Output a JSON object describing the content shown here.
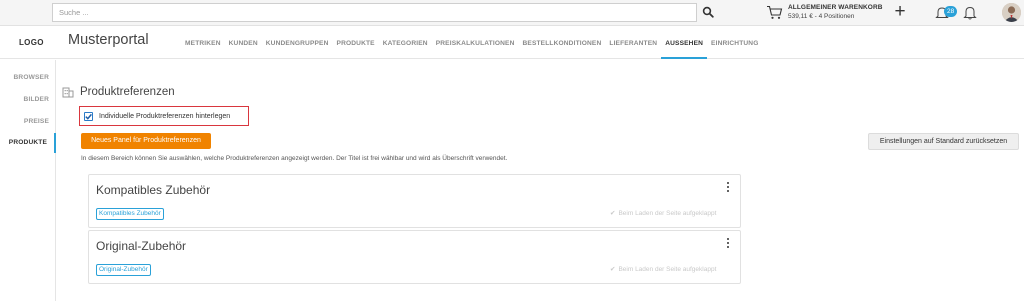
{
  "topbar": {
    "search_placeholder": "Suche ...",
    "cart_title": "ALLGEMEINER WARENKORB",
    "cart_summary": "539,11 € - 4 Positionen",
    "plus_label": "+",
    "notification_count": "28"
  },
  "header": {
    "logo": "LOGO",
    "portal_name": "Musterportal",
    "nav": [
      "METRIKEN",
      "KUNDEN",
      "KUNDENGRUPPEN",
      "PRODUKTE",
      "KATEGORIEN",
      "PREISKALKULATIONEN",
      "BESTELLKONDITIONEN",
      "LIEFERANTEN",
      "AUSSEHEN",
      "EINRICHTUNG"
    ],
    "active_nav": "AUSSEHEN"
  },
  "sidebar": {
    "items": [
      "BROWSER",
      "BILDER",
      "PREISE",
      "PRODUKTE"
    ],
    "active": "PRODUKTE"
  },
  "main": {
    "section_title": "Produktreferenzen",
    "checkbox_label": "Individuelle Produktreferenzen hinterlegen",
    "checkbox_checked": true,
    "new_panel_button": "Neues Panel für Produktreferenzen",
    "reset_button": "Einstellungen auf Standard zurücksetzen",
    "description": "In diesem Bereich können Sie auswählen, welche Produktreferenzen angezeigt werden. Der Titel ist frei wählbar und wird als Überschrift verwendet.",
    "panels": [
      {
        "title": "Kompatibles Zubehör",
        "tag": "Kompatibles Zubehör",
        "expanded_label": "Beim Laden der Seite aufgeklappt"
      },
      {
        "title": "Original-Zubehör",
        "tag": "Original-Zubehör",
        "expanded_label": "Beim Laden der Seite aufgeklappt"
      }
    ]
  },
  "colors": {
    "accent": "#2aa1d8",
    "primary_button": "#f08300",
    "highlight_border": "#d9363e"
  },
  "icons": [
    "search-icon",
    "cart-icon",
    "plus-icon",
    "notification-icon",
    "bell-icon",
    "avatar",
    "building-icon",
    "checkmark-icon",
    "more-vertical-icon"
  ]
}
